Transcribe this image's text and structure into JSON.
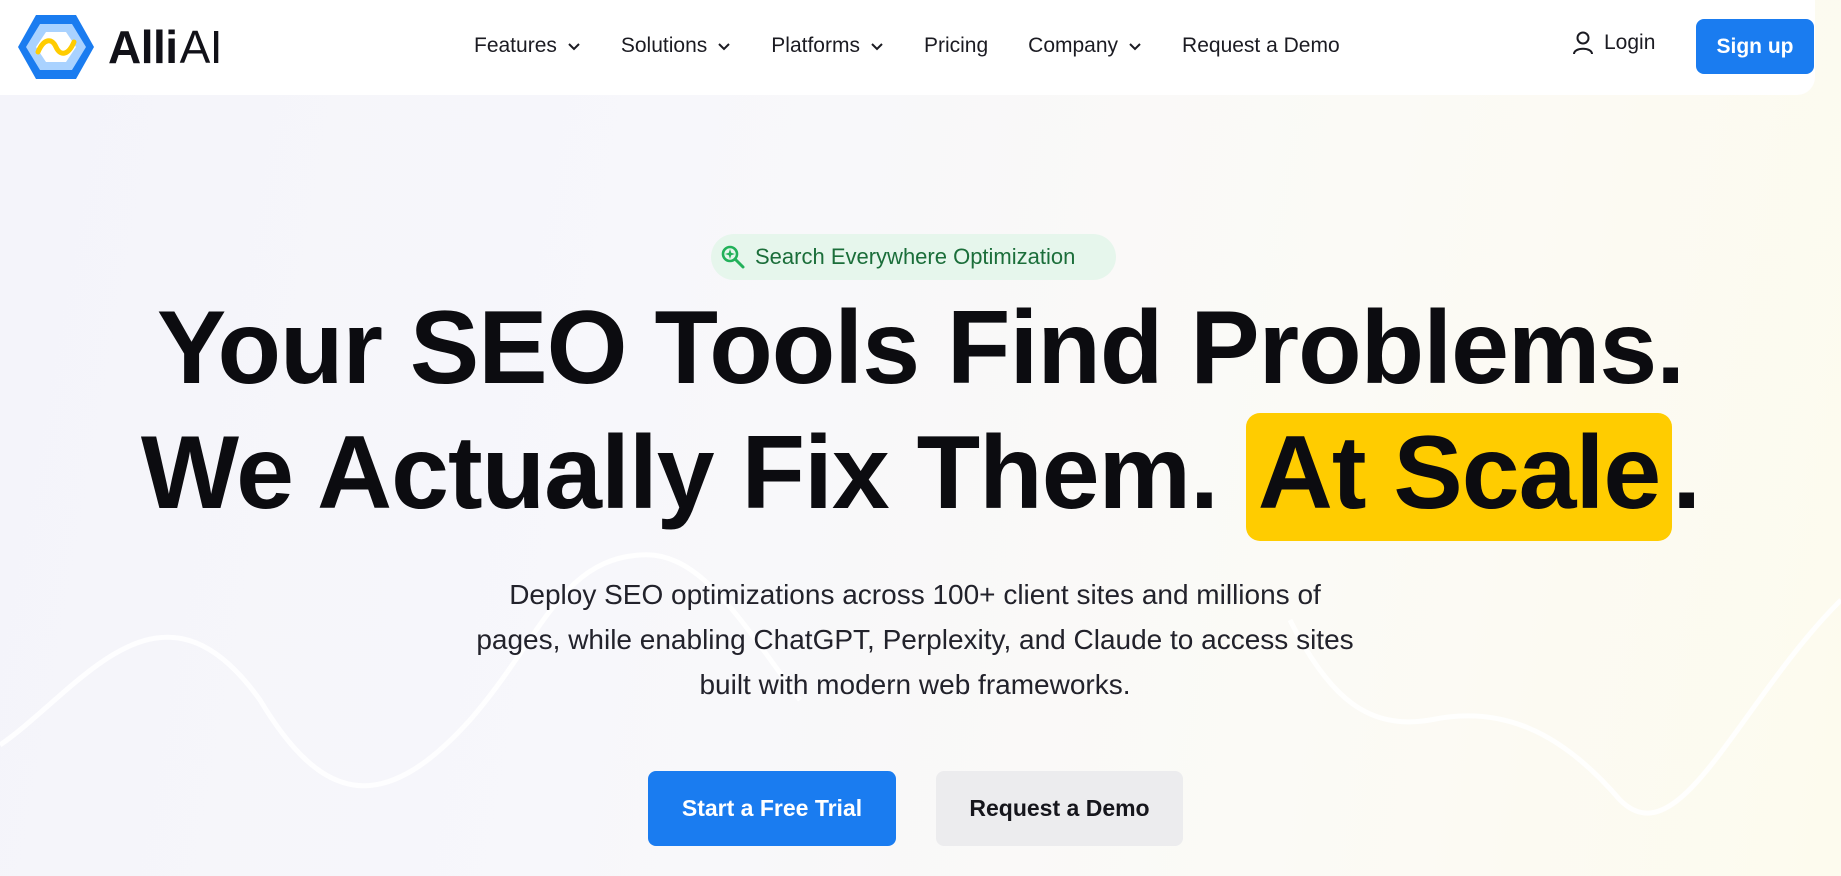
{
  "brand": {
    "name_part1": "Alli",
    "name_part2": "AI",
    "colors": {
      "logo_dark": "#1a7cf0",
      "logo_light": "#a9d2ff",
      "logo_accent": "#ffcc00"
    }
  },
  "nav": {
    "items": [
      {
        "label": "Features",
        "has_dropdown": true
      },
      {
        "label": "Solutions",
        "has_dropdown": true
      },
      {
        "label": "Platforms",
        "has_dropdown": true
      },
      {
        "label": "Pricing",
        "has_dropdown": false
      },
      {
        "label": "Company",
        "has_dropdown": true
      },
      {
        "label": "Request a Demo",
        "has_dropdown": false
      }
    ],
    "login_label": "Login",
    "signup_label": "Sign up"
  },
  "hero": {
    "pill_label": "Search Everywhere Optimization",
    "headline_line1": "Your SEO Tools Find Problems.",
    "headline_line2_prefix": "We Actually Fix Them. ",
    "headline_line2_highlight": "At Scale",
    "headline_line2_suffix": ".",
    "subtext_line1": "Deploy SEO optimizations across 100+ client sites and millions of",
    "subtext_line2": "pages, while enabling ChatGPT, Perplexity, and Claude to access sites",
    "subtext_line3": "built with modern web frameworks.",
    "primary_cta": "Start a Free Trial",
    "secondary_cta": "Request a Demo"
  },
  "colors": {
    "primary": "#1a7cf0",
    "highlight": "#ffcc00",
    "pill_bg": "#e6f6ec",
    "pill_text": "#1b6e3a"
  }
}
